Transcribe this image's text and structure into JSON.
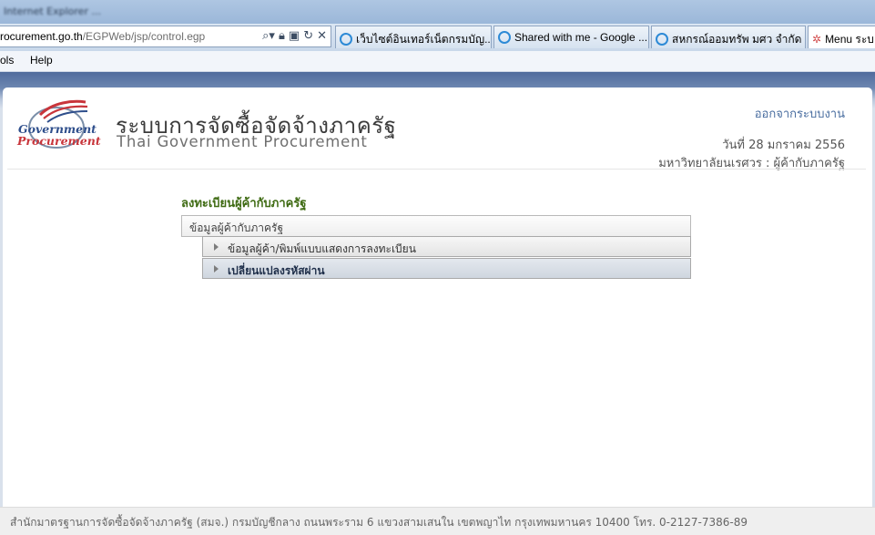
{
  "browser": {
    "title_blurred": "Internet Explorer ...",
    "address": {
      "host": "rocurement.go.th",
      "path": "/EGPWeb/jsp/control.egp"
    },
    "tabs": [
      {
        "label": "เว็บไซต์อินเทอร์เน็ตกรมบัญ..."
      },
      {
        "label": "Shared with me - Google ..."
      },
      {
        "label": "สหกรณ์ออมทรัพ มศว จำกัด"
      },
      {
        "label": "Menu ระบ"
      }
    ],
    "menu": [
      "ols",
      "Help"
    ]
  },
  "header": {
    "logo_line1": "Government",
    "logo_line2": "Procurement",
    "title_th": "ระบบการจัดซื้อจัดจ้างภาครัฐ",
    "title_en": "Thai Government Procurement",
    "logout": "ออกจากระบบงาน",
    "date": "วันที่ 28 มกราคม 2556",
    "organization": "มหาวิทยาลัยนเรศวร : ผู้ค้ากับภาครัฐ"
  },
  "main": {
    "section_title": "ลงทะเบียนผู้ค้ากับภาครัฐ",
    "group_header": "ข้อมูลผู้ค้ากับภาครัฐ",
    "items": [
      {
        "label": "ข้อมูลผู้ค้า/พิมพ์แบบแสดงการลงทะเบียน"
      },
      {
        "label": "เปลี่ยนแปลงรหัสผ่าน"
      }
    ]
  },
  "footer": {
    "text": "สำนักมาตรฐานการจัดซื้อจัดจ้างภาครัฐ (สมจ.) กรมบัญชีกลาง ถนนพระราม 6 แขวงสามเสนใน เขตพญาไท กรุงเทพมหานคร 10400 โทร. 0-2127-7386-89"
  },
  "colors": {
    "section_title": "#3f6b13",
    "logout_link": "#4a6ea0",
    "page_band": "#5a75a6"
  }
}
